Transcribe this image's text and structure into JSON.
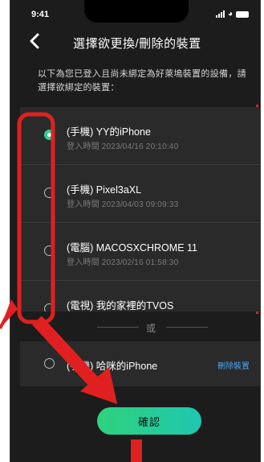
{
  "status_bar": {
    "time": "9:41"
  },
  "header": {
    "title": "選擇欲更換/刪除的裝置"
  },
  "description": "以下為您已登入且尚未綁定為好萊塢裝置的設備，請選擇欲綁定的裝置：",
  "devices": [
    {
      "name": "(手機) YY的iPhone",
      "login": "登入時間  2023/04/16  20:10:40",
      "selected": true
    },
    {
      "name": "(手機) Pixel3aXL",
      "login": "登入時間  2023/04/03  09:09:33",
      "selected": false
    },
    {
      "name": "(電腦) MACOSXCHROME 11",
      "login": "登入時間  2023/02/16  01:58:30",
      "selected": false
    },
    {
      "name": "(電視) 我的家裡的TVOS",
      "login": "",
      "selected": false
    }
  ],
  "divider": {
    "or_text": "或"
  },
  "bound_device": {
    "name": "(手機) 哈咪的iPhone",
    "delete_label": "刪除裝置"
  },
  "confirm_button": {
    "label": "確認"
  },
  "colors": {
    "accent": "#2ecc9a",
    "annotation_red": "#e02020",
    "link": "#4aa3f0",
    "background": "#1c1c1c",
    "card": "#2a2a2a"
  },
  "icons": [
    "back-chevron-icon",
    "signal-icon",
    "wifi-icon",
    "battery-icon",
    "radio-selected-icon",
    "radio-icon",
    "red-arrow-annotation"
  ]
}
